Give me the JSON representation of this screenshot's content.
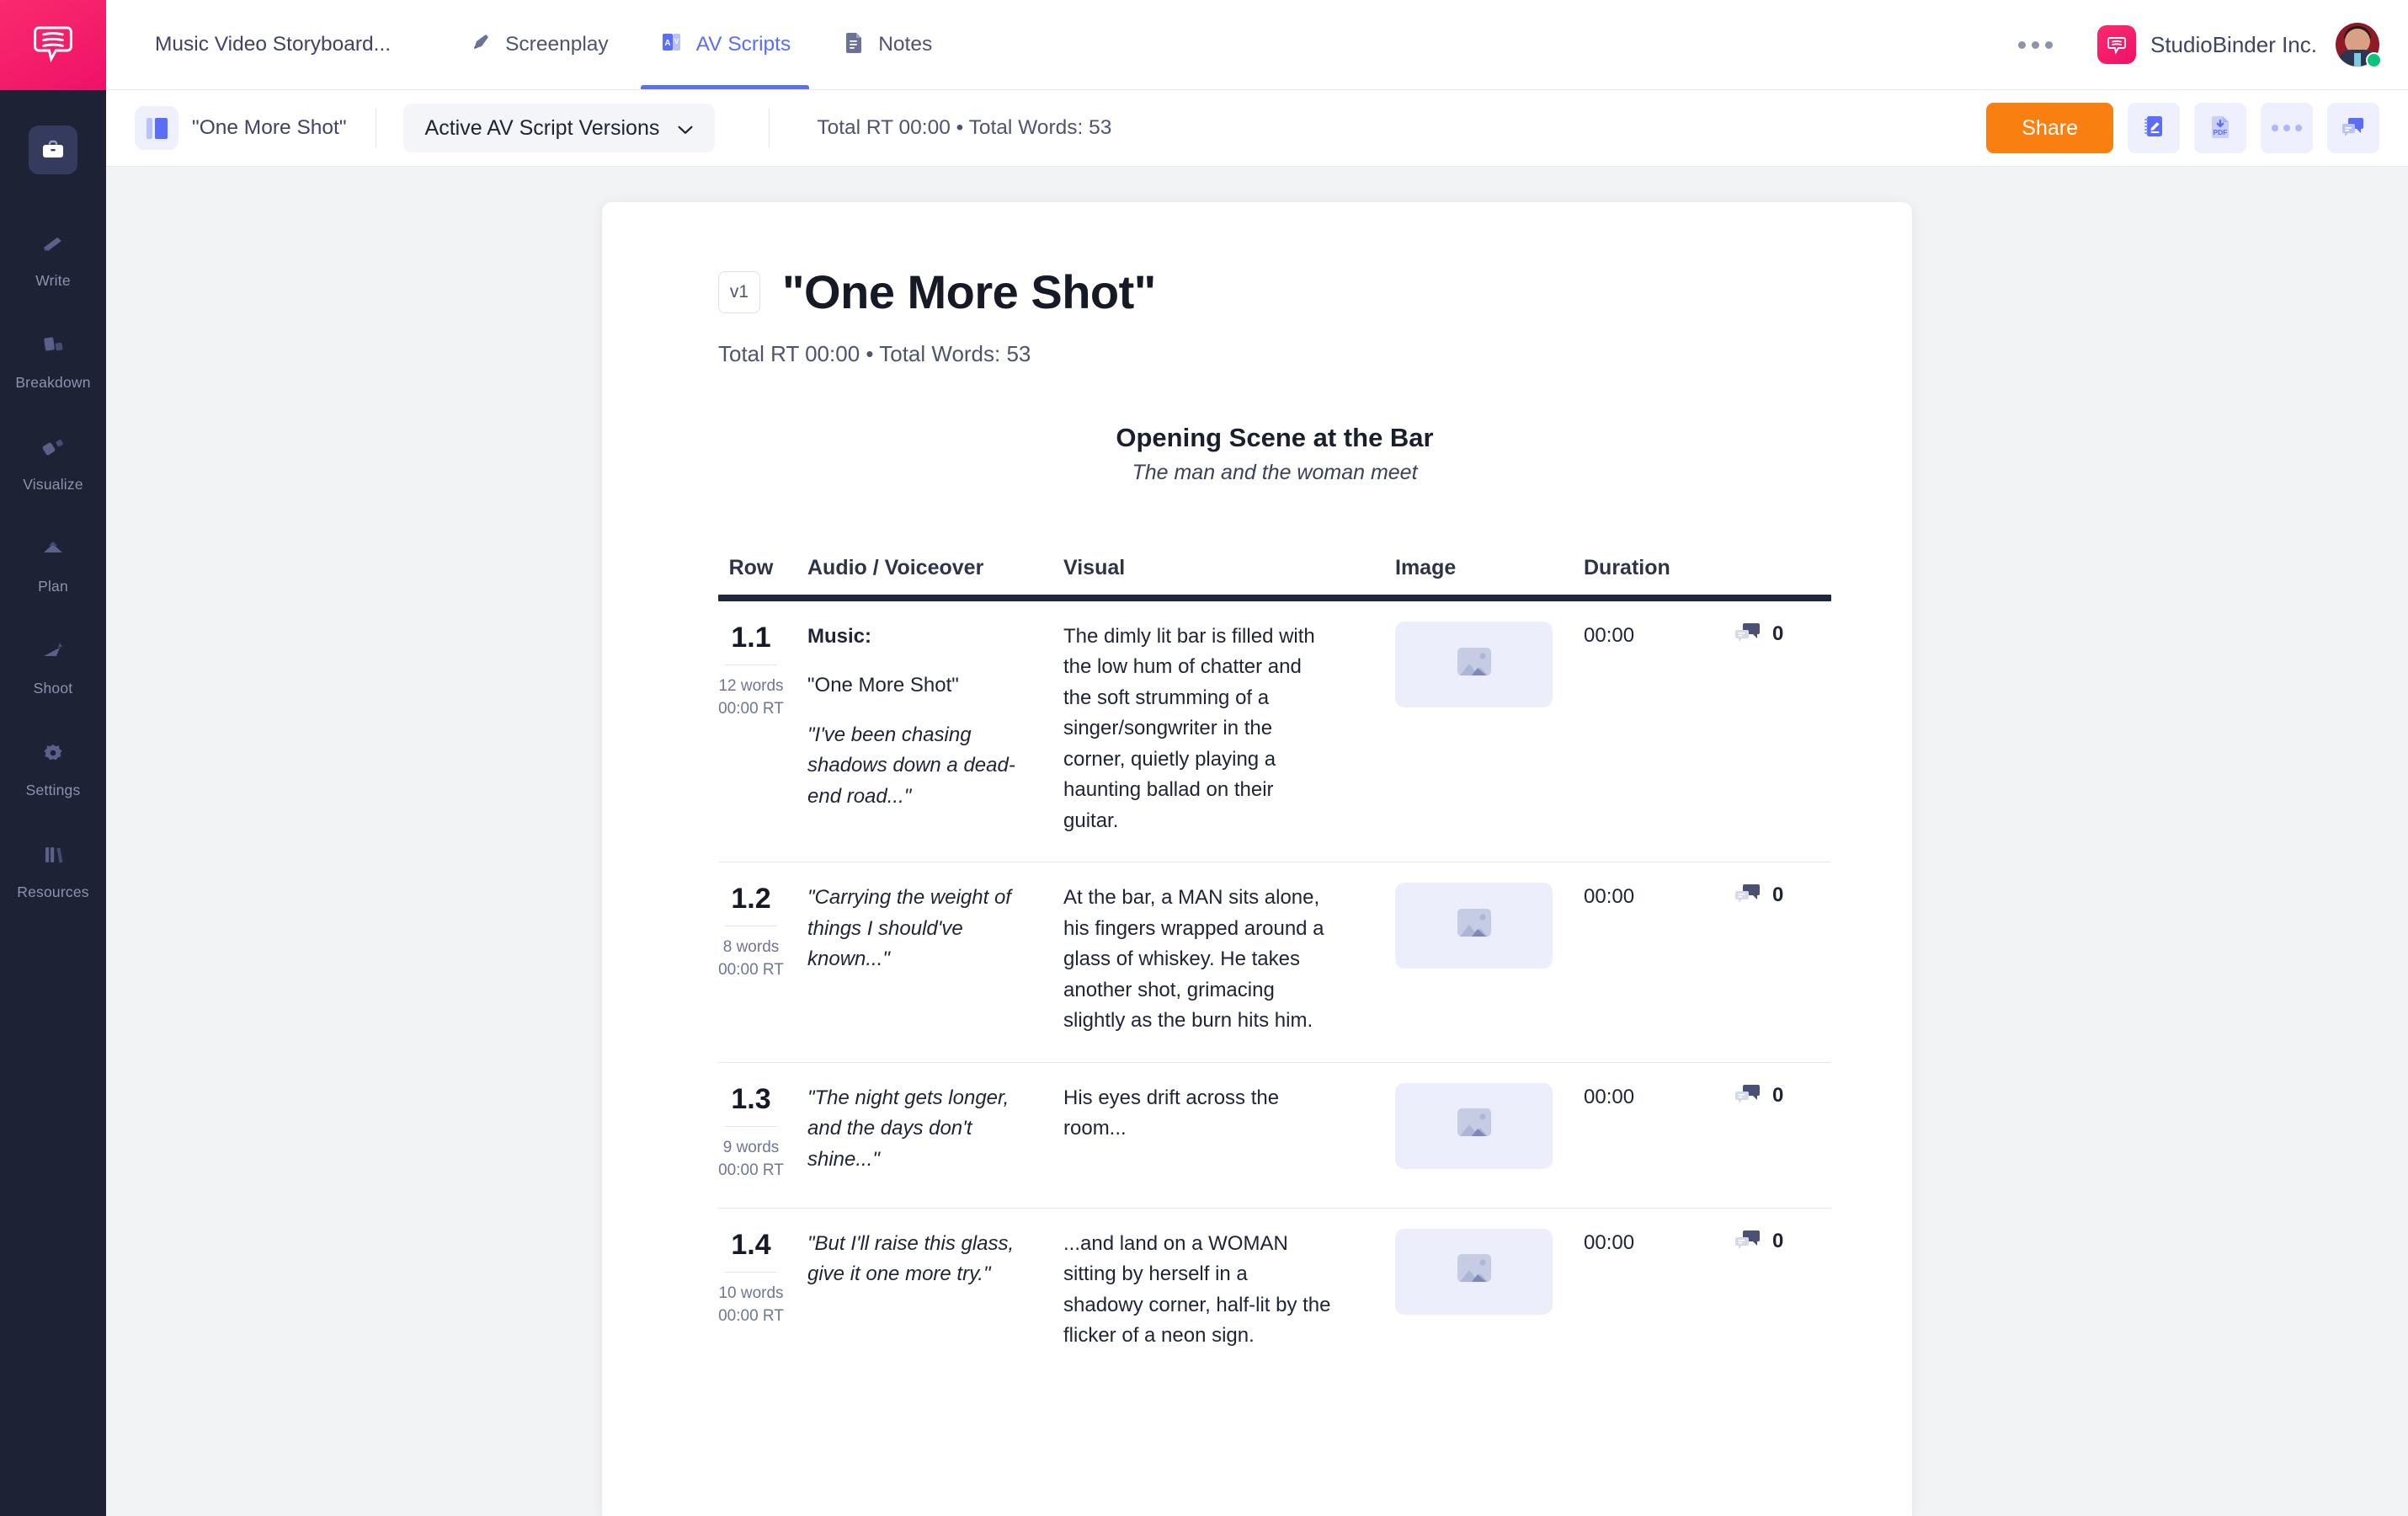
{
  "rail": {
    "logo_icon": "studiobinder-chat-logo",
    "items": [
      {
        "label": "",
        "icon": "briefcase-icon",
        "active": true,
        "name": "projects"
      },
      {
        "label": "Write",
        "icon": "write-icon",
        "active": false,
        "name": "write"
      },
      {
        "label": "Breakdown",
        "icon": "breakdown-icon",
        "active": false,
        "name": "breakdown"
      },
      {
        "label": "Visualize",
        "icon": "visualize-icon",
        "active": false,
        "name": "visualize"
      },
      {
        "label": "Plan",
        "icon": "plan-icon",
        "active": false,
        "name": "plan"
      },
      {
        "label": "Shoot",
        "icon": "shoot-icon",
        "active": false,
        "name": "shoot"
      },
      {
        "label": "Settings",
        "icon": "gear-icon",
        "active": false,
        "name": "settings"
      },
      {
        "label": "Resources",
        "icon": "resources-icon",
        "active": false,
        "name": "resources"
      }
    ]
  },
  "topbar": {
    "project_name": "Music Video Storyboard...",
    "tabs": [
      {
        "label": "Screenplay",
        "icon": "pen-icon",
        "active": false
      },
      {
        "label": "AV Scripts",
        "icon": "av-icon",
        "active": true
      },
      {
        "label": "Notes",
        "icon": "notes-icon",
        "active": false
      }
    ],
    "more_icon": "ellipsis-icon",
    "org_name": "StudioBinder Inc.",
    "org_badge_icon": "studiobinder-chat-logo",
    "avatar_name": "user-avatar",
    "presence": "online"
  },
  "subbar": {
    "doc_icon": "av-script-doc-icon",
    "doc_title": "\"One More Shot\"",
    "version_select": "Active AV Script Versions",
    "chevron_icon": "chevron-down-icon",
    "stats": "Total RT 00:00 • Total Words: 53",
    "share_label": "Share",
    "actions": [
      {
        "name": "notebook-edit-button",
        "icon": "notebook-pencil-icon"
      },
      {
        "name": "export-pdf-button",
        "icon": "pdf-download-icon"
      },
      {
        "name": "more-options-button",
        "icon": "ellipsis-icon"
      },
      {
        "name": "comments-button",
        "icon": "comment-bubbles-icon"
      }
    ]
  },
  "document": {
    "version_badge": "v1",
    "title": "\"One More Shot\"",
    "stats": "Total RT 00:00 • Total Words: 53",
    "scene_title": "Opening Scene at the Bar",
    "scene_subtitle": "The man and the woman meet",
    "columns": [
      "Row",
      "Audio / Voiceover",
      "Visual",
      "Image",
      "Duration"
    ],
    "rows": [
      {
        "number": "1.1",
        "words": "12 words",
        "rt": "00:00 RT",
        "audio": [
          {
            "text": "Music:",
            "style": "bold"
          },
          {
            "text": "\"One More Shot\"",
            "style": "normal"
          },
          {
            "text": "\"I've been chasing shadows down a dead-end road...\"",
            "style": "italic"
          }
        ],
        "visual": "The dimly lit bar is filled with the low hum of chatter and the soft strumming of a singer/songwriter in the corner, quietly playing a haunting ballad on their guitar.",
        "image_placeholder_icon": "image-placeholder-icon",
        "duration": "00:00",
        "comment_icon": "comment-icon",
        "comment_count": "0"
      },
      {
        "number": "1.2",
        "words": "8 words",
        "rt": "00:00 RT",
        "audio": [
          {
            "text": "\"Carrying the weight of things I should've known...\"",
            "style": "italic"
          }
        ],
        "visual": "At the bar, a MAN sits alone, his fingers wrapped around a glass of whiskey. He takes another shot, grimacing slightly as the burn hits him.",
        "image_placeholder_icon": "image-placeholder-icon",
        "duration": "00:00",
        "comment_icon": "comment-icon",
        "comment_count": "0"
      },
      {
        "number": "1.3",
        "words": "9 words",
        "rt": "00:00 RT",
        "audio": [
          {
            "text": "\"The night gets longer, and the days don't shine...\"",
            "style": "italic"
          }
        ],
        "visual": "His eyes drift across the room...",
        "image_placeholder_icon": "image-placeholder-icon",
        "duration": "00:00",
        "comment_icon": "comment-icon",
        "comment_count": "0"
      },
      {
        "number": "1.4",
        "words": "10 words",
        "rt": "00:00 RT",
        "audio": [
          {
            "text": "\"But I'll raise this glass, give it one more try.\"",
            "style": "italic"
          }
        ],
        "visual": "...and land on a WOMAN sitting by herself in a shadowy corner, half-lit by the flicker of a neon sign.",
        "image_placeholder_icon": "image-placeholder-icon",
        "duration": "00:00",
        "comment_icon": "comment-icon",
        "comment_count": "0"
      }
    ]
  },
  "colors": {
    "brand_pink": "#ef1168",
    "accent_blue": "#5b6ef5",
    "share_orange": "#f98010",
    "rail_dark": "#1e2235",
    "canvas_gray": "#f2f3f5",
    "presence_green": "#0bc47c"
  }
}
